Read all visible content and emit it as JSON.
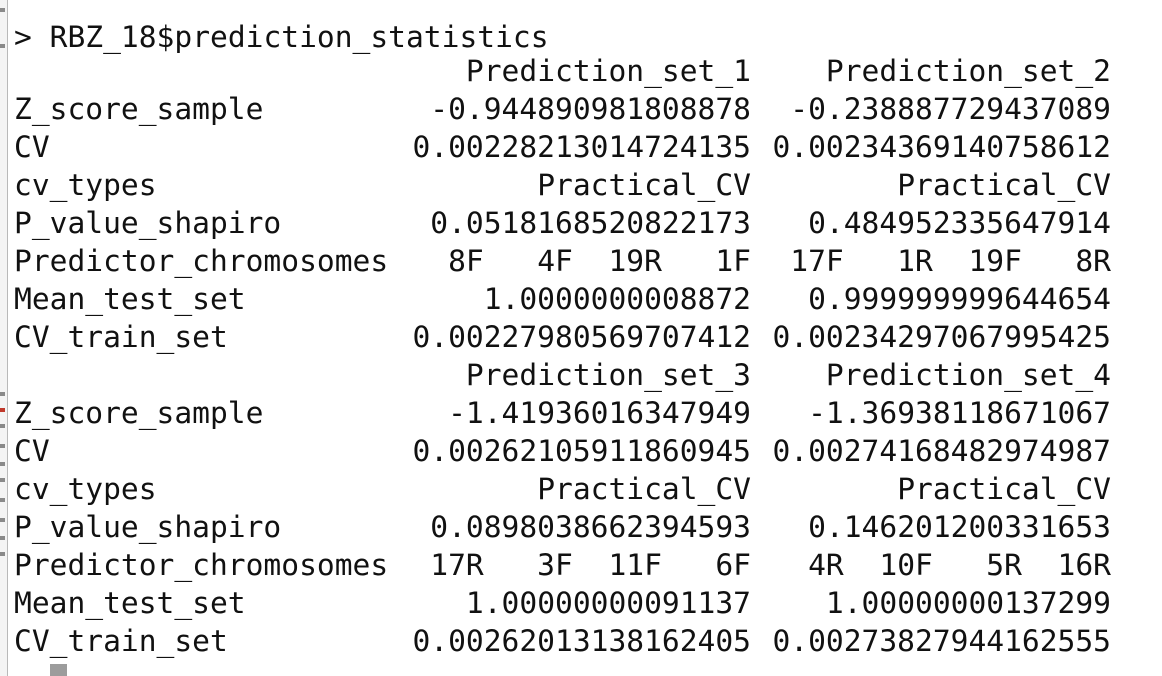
{
  "console": {
    "previous_prompt": ">",
    "prompt": ">",
    "command": "RBZ_18$prediction_statistics"
  },
  "blocks": [
    {
      "headers": [
        "Prediction_set_1",
        "Prediction_set_2"
      ],
      "rows": [
        {
          "label": "Z_score_sample",
          "values": [
            "-0.944890981808878",
            "-0.238887729437089"
          ]
        },
        {
          "label": "CV",
          "values": [
            "0.00228213014724135",
            "0.00234369140758612"
          ]
        },
        {
          "label": "cv_types",
          "values": [
            "Practical_CV",
            "Practical_CV"
          ]
        },
        {
          "label": "P_value_shapiro",
          "values": [
            "0.0518168520822173",
            "0.484952335647914"
          ]
        },
        {
          "label": "Predictor_chromosomes",
          "values": [
            "8F   4F  19R   1F",
            "17F   1R  19F   8R"
          ]
        },
        {
          "label": "Mean_test_set",
          "values": [
            "1.0000000008872",
            "0.999999999644654"
          ]
        },
        {
          "label": "CV_train_set",
          "values": [
            "0.00227980569707412",
            "0.00234297067995425"
          ]
        }
      ]
    },
    {
      "headers": [
        "Prediction_set_3",
        "Prediction_set_4"
      ],
      "rows": [
        {
          "label": "Z_score_sample",
          "values": [
            "-1.41936016347949",
            "-1.36938118671067"
          ]
        },
        {
          "label": "CV",
          "values": [
            "0.00262105911860945",
            "0.00274168482974987"
          ]
        },
        {
          "label": "cv_types",
          "values": [
            "Practical_CV",
            "Practical_CV"
          ]
        },
        {
          "label": "P_value_shapiro",
          "values": [
            "0.0898038662394593",
            "0.146201200331653"
          ]
        },
        {
          "label": "Predictor_chromosomes",
          "values": [
            "17R   3F  11F   6F",
            "4R  10F   5R  16R"
          ]
        },
        {
          "label": "Mean_test_set",
          "values": [
            "1.00000000091137",
            "1.00000000137299"
          ]
        },
        {
          "label": "CV_train_set",
          "values": [
            "0.00262013138162405",
            "0.00273827944162555"
          ]
        }
      ]
    }
  ]
}
